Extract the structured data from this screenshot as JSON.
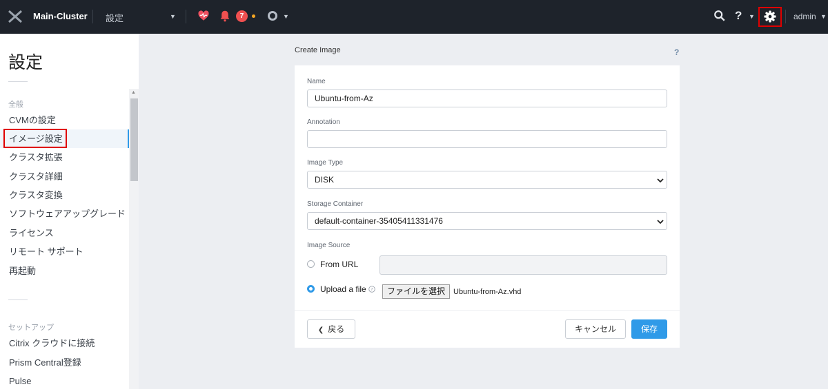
{
  "topbar": {
    "cluster_name": "Main-Cluster",
    "section": "設定",
    "alert_count": "7",
    "user": "admin"
  },
  "sidebar": {
    "title": "設定",
    "groups": [
      {
        "label": "全般",
        "items": [
          "CVMの設定",
          "イメージ設定",
          "クラスタ拡張",
          "クラスタ詳細",
          "クラスタ変換",
          "ソフトウェアアップグレード",
          "ライセンス",
          "リモート サポート",
          "再起動"
        ]
      },
      {
        "label": "セットアップ",
        "items": [
          "Citrix クラウドに接続",
          "Prism Central登録",
          "Pulse"
        ]
      }
    ],
    "active_item": "イメージ設定"
  },
  "dialog": {
    "title": "Create Image",
    "help": "?",
    "name_label": "Name",
    "name_value": "Ubuntu-from-Az",
    "annotation_label": "Annotation",
    "annotation_value": "",
    "image_type_label": "Image Type",
    "image_type_value": "DISK",
    "storage_label": "Storage Container",
    "storage_value": "default-container-35405411331476",
    "source_label": "Image Source",
    "from_url_label": "From URL",
    "upload_label": "Upload a file",
    "choose_file_label": "ファイルを選択",
    "file_name": "Ubuntu-from-Az.vhd",
    "back_label": "戻る",
    "cancel_label": "キャンセル",
    "save_label": "保存"
  },
  "colors": {
    "topbar_bg": "#1e232b",
    "accent": "#2f9ae8",
    "alert": "#f05050",
    "highlight_box": "#e00000"
  }
}
